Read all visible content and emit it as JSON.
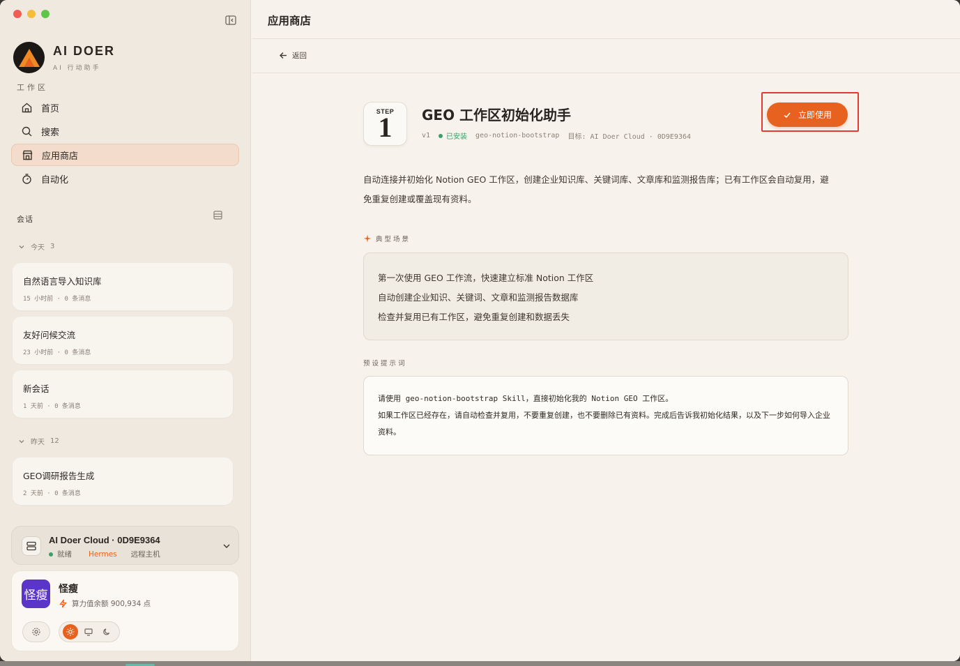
{
  "sidebar": {
    "brand": {
      "name": "AI DOER",
      "subtitle": "AI 行动助手"
    },
    "workspace_label": "工作区",
    "nav": [
      {
        "label": "首页",
        "icon": "home-icon"
      },
      {
        "label": "搜索",
        "icon": "search-icon"
      },
      {
        "label": "应用商店",
        "icon": "store-icon",
        "active": true
      },
      {
        "label": "自动化",
        "icon": "timer-icon"
      }
    ],
    "conversations_label": "会话",
    "groups": [
      {
        "label": "今天",
        "count": "3"
      },
      {
        "label": "昨天",
        "count": "12"
      }
    ],
    "conversations": [
      {
        "title": "自然语言导入知识库",
        "meta": "15 小时前 · 0 条消息"
      },
      {
        "title": "友好问候交流",
        "meta": "23 小时前 · 0 条消息"
      },
      {
        "title": "新会话",
        "meta": "1 天前 · 0 条消息"
      },
      {
        "title": "GEO调研报告生成",
        "meta": "2 天前 · 0 条消息"
      }
    ],
    "host": {
      "title": "AI Doer Cloud · 0D9E9364",
      "status": "就绪",
      "engine": "Hermes",
      "type": "远程主机"
    },
    "user": {
      "avatar_text": "怪瘦",
      "name": "怪瘦",
      "credit": "算力值余额 900,934 点"
    }
  },
  "main": {
    "page_title": "应用商店",
    "back_label": "返回",
    "app": {
      "icon_step": "STEP",
      "icon_num": "1",
      "title": "GEO 工作区初始化助手",
      "version": "v1",
      "installed": "已安装",
      "slug": "geo-notion-bootstrap",
      "target": "目标: AI Doer Cloud · 0D9E9364",
      "use_button": "立即使用",
      "description": "自动连接并初始化 Notion GEO 工作区，创建企业知识库、关键词库、文章库和监测报告库；已有工作区会自动复用，避免重复创建或覆盖现有资料。"
    },
    "scenarios_label": "典型场景",
    "scenarios": [
      "第一次使用 GEO 工作流，快速建立标准 Notion 工作区",
      "自动创建企业知识、关键词、文章和监测报告数据库",
      "检查并复用已有工作区，避免重复创建和数据丢失"
    ],
    "prompt_label": "预设提示词",
    "prompt_lines": [
      "请使用 geo-notion-bootstrap Skill，直接初始化我的 Notion GEO 工作区。",
      "如果工作区已经存在，请自动检查并复用，不要重复创建，也不要删除已有资料。完成后告诉我初始化结果，以及下一步如何导入企业资料。"
    ]
  },
  "colors": {
    "accent": "#e8621f",
    "installed": "#3e9e6a",
    "highlight_frame": "#e33b32",
    "avatar": "#5a35c8"
  }
}
